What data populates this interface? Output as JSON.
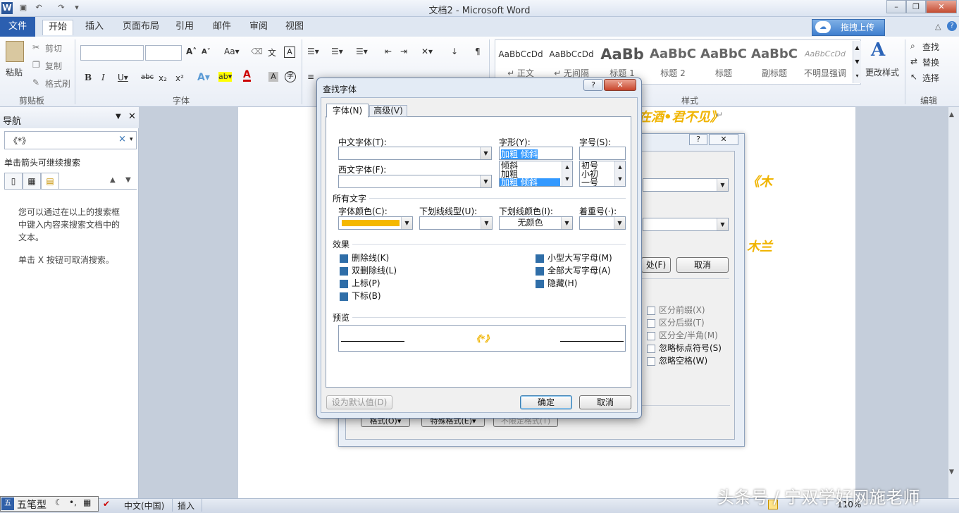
{
  "window": {
    "title": "文档2 - Microsoft Word"
  },
  "ribbon": {
    "file_tab": "文件",
    "tabs": [
      "开始",
      "插入",
      "页面布局",
      "引用",
      "邮件",
      "审阅",
      "视图"
    ],
    "upload_button": "拖拽上传",
    "clipboard": {
      "paste": "粘贴",
      "cut": "剪切",
      "copy": "复制",
      "format_painter": "格式刷",
      "group": "剪贴板"
    },
    "font_group": "字体",
    "styles": {
      "tiles": [
        {
          "sample": "AaBbCcDd",
          "name": "↵ 正文"
        },
        {
          "sample": "AaBbCcDd",
          "name": "↵ 无间隔"
        },
        {
          "sample": "AaBb",
          "name": "标题 1"
        },
        {
          "sample": "AaBbC",
          "name": "标题 2"
        },
        {
          "sample": "AaBbC",
          "name": "标题"
        },
        {
          "sample": "AaBbC",
          "name": "副标题"
        },
        {
          "sample": "AaBbCcDd",
          "name": "不明显强调"
        }
      ],
      "change_styles": "更改样式",
      "group": "样式"
    },
    "editing": {
      "find": "查找",
      "replace": "替换",
      "select": "选择",
      "group": "编辑"
    }
  },
  "nav": {
    "title": "导航",
    "search_value": "《*》",
    "hint": "单击箭头可继续搜索",
    "message1": "您可以通过在以上的搜索框中键入内容来搜索文档中的文本。",
    "message2": "单击 X 按钮可取消搜索。"
  },
  "document": {
    "heading_fragment": "在酒•君不见》",
    "fragment_a": "《木",
    "fragment_b": "木兰"
  },
  "find_replace": {
    "find_in_button": "处(F)",
    "cancel": "取消",
    "options": [
      {
        "label": "区分前缀(X)"
      },
      {
        "label": "区分后缀(T)"
      },
      {
        "label": "区分全/半角(M)"
      },
      {
        "label": "忽略标点符号(S)"
      },
      {
        "label": "忽略空格(W)"
      }
    ],
    "bottom_buttons": [
      "格式(O)▾",
      "特殊格式(E)▾",
      "不限定格式(T)"
    ]
  },
  "find_font": {
    "title": "查找字体",
    "tabs": [
      "字体(N)",
      "高级(V)"
    ],
    "cn_font_label": "中文字体(T):",
    "west_font_label": "西文字体(F):",
    "style_label": "字形(Y):",
    "style_value": "加粗 倾斜",
    "style_options": [
      "倾斜",
      "加粗",
      "加粗 倾斜"
    ],
    "size_label": "字号(S):",
    "size_options": [
      "初号",
      "小初",
      "一号"
    ],
    "all_text_label": "所有文字",
    "color_label": "字体颜色(C):",
    "color_value": "#f5b800",
    "underline_label": "下划线线型(U):",
    "underline_color_label": "下划线颜色(I):",
    "underline_color_value": "无颜色",
    "emphasis_label": "着重号(·):",
    "effects_label": "效果",
    "effects_left": [
      "删除线(K)",
      "双删除线(L)",
      "上标(P)",
      "下标(B)"
    ],
    "effects_right": [
      "小型大写字母(M)",
      "全部大写字母(A)",
      "隐藏(H)"
    ],
    "preview_label": "预览",
    "preview_text": "《*》",
    "set_default": "设为默认值(D)",
    "ok": "确定",
    "cancel": "取消"
  },
  "status": {
    "ime": "五笔型",
    "language": "中文(中国)",
    "mode": "插入",
    "zoom": "110%"
  },
  "watermark": "头条号 / 宁双学好网施老师"
}
